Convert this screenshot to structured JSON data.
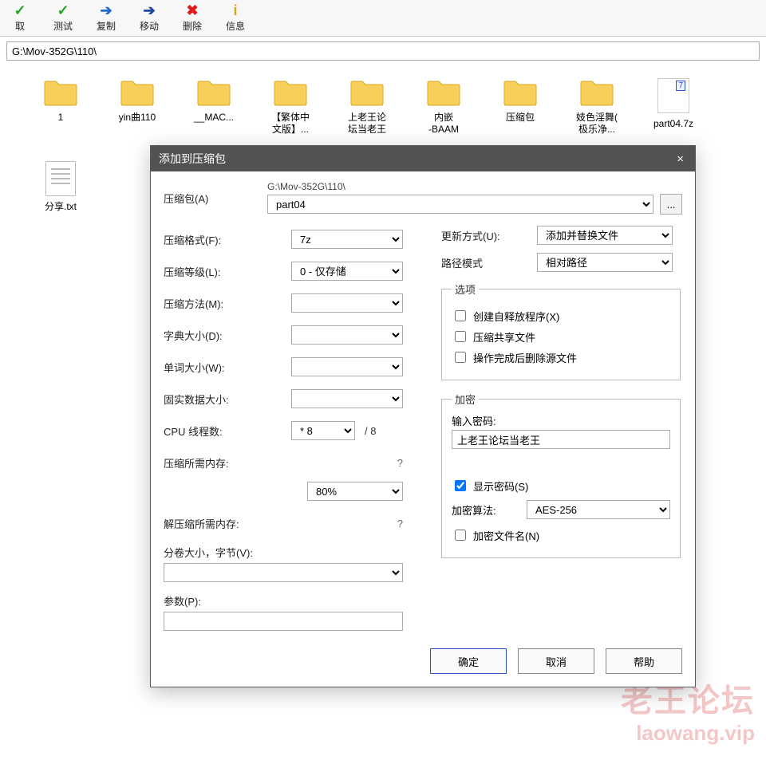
{
  "toolbar": [
    {
      "label": "取",
      "glyph": "✓",
      "cls": "c-green"
    },
    {
      "label": "测试",
      "glyph": "✓",
      "cls": "c-green"
    },
    {
      "label": "复制",
      "glyph": "➔",
      "cls": "c-blue arrow"
    },
    {
      "label": "移动",
      "glyph": "➔",
      "cls": "c-darkblue arrow"
    },
    {
      "label": "删除",
      "glyph": "✖",
      "cls": "c-red"
    },
    {
      "label": "信息",
      "glyph": "i",
      "cls": "c-yellow"
    }
  ],
  "address": "G:\\Mov-352G\\110\\",
  "files": [
    {
      "name": "1",
      "type": "folder"
    },
    {
      "name": "yin曲110",
      "type": "folder"
    },
    {
      "name": "__MAC...",
      "type": "folder"
    },
    {
      "name": "【繁体中",
      "name2": "文版】...",
      "type": "folder"
    },
    {
      "name": "上老王论",
      "name2": "坛当老王",
      "type": "folder"
    },
    {
      "name": "内嵌",
      "name2": "-BAAM",
      "type": "folder"
    },
    {
      "name": "压缩包",
      "type": "folder"
    },
    {
      "name": "妓色淫舞(",
      "name2": "极乐净...",
      "type": "folder"
    },
    {
      "name": "part04.7z",
      "type": "archive"
    },
    {
      "name": "分享.txt",
      "type": "doc"
    }
  ],
  "dialog": {
    "title": "添加到压缩包",
    "archive_label": "压缩包(A)",
    "archive_path": "G:\\Mov-352G\\110\\",
    "archive_name": "part04",
    "browse": "...",
    "close": "×",
    "left": {
      "format_label": "压缩格式(F):",
      "format_value": "7z",
      "level_label": "压缩等级(L):",
      "level_value": "0 - 仅存储",
      "method_label": "压缩方法(M):",
      "method_value": "",
      "dict_label": "字典大小(D):",
      "dict_value": "",
      "word_label": "单词大小(W):",
      "word_value": "",
      "solid_label": "固实数据大小:",
      "solid_value": "",
      "cpu_label": "CPU 线程数:",
      "cpu_value": "* 8",
      "cpu_total": "/ 8",
      "mem_comp_label": "压缩所需内存:",
      "mem_comp_value": "80%",
      "mem_comp_q": "?",
      "mem_decomp_label": "解压缩所需内存:",
      "mem_decomp_q": "?",
      "split_label": "分卷大小，字节(V):",
      "param_label": "参数(P):"
    },
    "right": {
      "update_label": "更新方式(U):",
      "update_value": "添加并替换文件",
      "pathmode_label": "路径模式",
      "pathmode_value": "相对路径",
      "options_legend": "选项",
      "opt_sfx": "创建自释放程序(X)",
      "opt_share": "压缩共享文件",
      "opt_delete": "操作完成后删除源文件",
      "enc_legend": "加密",
      "pw_label": "输入密码:",
      "pw_value": "上老王论坛当老王",
      "show_pw": "显示密码(S)",
      "algo_label": "加密算法:",
      "algo_value": "AES-256",
      "enc_names": "加密文件名(N)"
    },
    "buttons": {
      "ok": "确定",
      "cancel": "取消",
      "help": "帮助"
    }
  },
  "watermark": {
    "line1": "老王论坛",
    "line2": "laowang.vip"
  }
}
